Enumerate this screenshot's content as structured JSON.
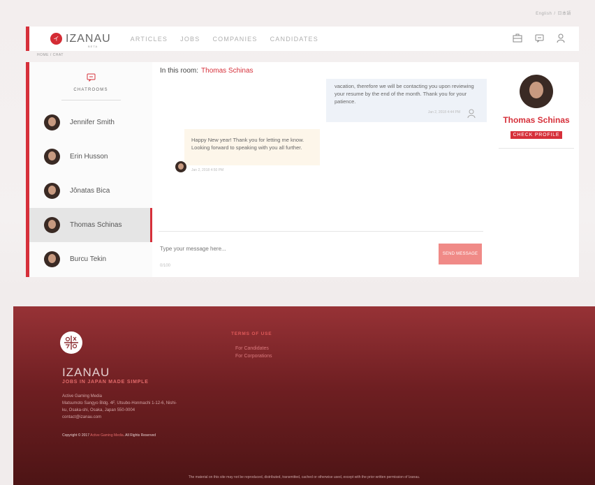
{
  "lang": {
    "english": "English",
    "japanese": "日本語"
  },
  "header": {
    "logo_mark": "イ",
    "logo_text": "IZANAU",
    "beta": "BETA",
    "nav": [
      "ARTICLES",
      "JOBS",
      "COMPANIES",
      "CANDIDATES"
    ],
    "icons": [
      "briefcase-icon",
      "chat-icon",
      "user-icon"
    ]
  },
  "breadcrumb": "HOME  /  CHAT",
  "sidebar": {
    "title": "CHATROOMS",
    "contacts": [
      "Jennifer Smith",
      "Erin Husson",
      "Jônatas Bica",
      "Thomas Schinas",
      "Burcu Tekin"
    ]
  },
  "room": {
    "label": "In this room:",
    "name": "Thomas Schinas"
  },
  "messages": {
    "outgoing": {
      "text": "vacation, therefore we will be contacting you upon reviewing your resume by the end of the month. Thank you for your patience.",
      "time": "Jan 2, 2018 4:44 PM"
    },
    "incoming": {
      "text": "Happy New year! Thank you for letting me know. Looking forward to speaking with you all further.",
      "time": "Jan 2, 2018 4:50 PM"
    }
  },
  "composer": {
    "placeholder": "Type your message here...",
    "counter": "0/100",
    "send": "SEND MESSAGE"
  },
  "profile": {
    "name": "Thomas Schinas",
    "check": "CHECK PROFILE"
  },
  "footer": {
    "brand": "IZANAU",
    "tagline": "JOBS IN JAPAN MADE SIMPLE",
    "company": "Active Gaming Media",
    "address1": "Matsumoto Sangyo Bldg. 4F, Utsubo-Honmachi 1-12-6, Nishi-",
    "address2": "ku, Osaka-shi, Osaka, Japan 550-0004",
    "email": "contact@izanau.com",
    "copyright_prefix": "Copyright © 2017",
    "copyright_company": "Active Gaming Media",
    "copyright_suffix": ". All Rights Reserved",
    "terms_title": "TERMS OF USE",
    "terms_links": [
      "For Candidates",
      "For Corporations"
    ],
    "disclaimer": "The material on this site may not be reproduced, distributed, transmitted, cached or otherwise used, except with the prior written permission of Izanau."
  }
}
